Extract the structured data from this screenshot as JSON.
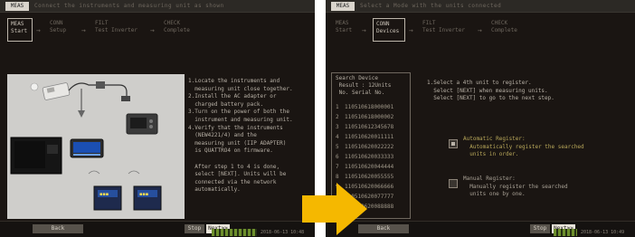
{
  "colors": {
    "arrow": "#f5b800",
    "screen_bg": "#1a1512",
    "highlight_option": "#b9a85a",
    "status_green": "#6d8f2c"
  },
  "left": {
    "title_tab": "MEAS",
    "topbar_text": "Connect the instruments and measuring unit as shown",
    "steps": [
      {
        "label": "MEAS\nStart"
      },
      {
        "label": "CONN\nSetup"
      },
      {
        "label": "FILT\nTest Inverter"
      },
      {
        "label": "CHECK\nComplete"
      }
    ],
    "instructions": "1.Locate the instruments and\n  measuring unit close together.\n2.Install the AC adapter or\n  charged battery pack.\n3.Turn on the power of both the\n  instrument and measuring unit.\n4.Verify that the instruments\n  (NEW4221/4) and the\n  measuring unit (IIP ADAPTER)\n  is QUATTRO4 on firmware.\n\n  After step 1 to 4 is done,\n  select [NEXT]. Units will be\n  connected via the network\n  automatically.",
    "buttons": {
      "back": "Back",
      "stop": "Stop",
      "next": "Next>>"
    },
    "status_text": "2018-06-13 10:48"
  },
  "right": {
    "title_tab": "MEAS",
    "topbar_text": "Select a Mode with the units connected",
    "steps": [
      {
        "label": "MEAS\nStart"
      },
      {
        "label": "CONN\nDevices"
      },
      {
        "label": "FILT\nTest Inverter"
      },
      {
        "label": "CHECK\nComplete"
      }
    ],
    "list": {
      "header": "Search Device\n Result : 12Units\n No. Serial No.",
      "rows": [
        {
          "idx": "1",
          "serial": "110510618000001"
        },
        {
          "idx": "2",
          "serial": "110510618000002"
        },
        {
          "idx": "3",
          "serial": "110510612345678"
        },
        {
          "idx": "4",
          "serial": "110510620011111"
        },
        {
          "idx": "5",
          "serial": "110510620022222"
        },
        {
          "idx": "6",
          "serial": "110510620033333"
        },
        {
          "idx": "7",
          "serial": "110510620044444"
        },
        {
          "idx": "8",
          "serial": "110510620055555"
        },
        {
          "idx": "9",
          "serial": "110510620066666"
        },
        {
          "idx": "10",
          "serial": "110510620077777"
        },
        {
          "idx": "11",
          "serial": "110510620088888"
        }
      ]
    },
    "instructions": "1.Select a 4th unit to register.\n  Select [NEXT] when measuring units.\n  Select [NEXT] to go to the next step.",
    "option_auto": "Automatic Register:\n  Automatically register the searched\n  units in order.",
    "option_manual": "Manual Register:\n  Manually register the searched\n  units one by one.",
    "buttons": {
      "back": "Back",
      "stop": "Stop",
      "next": "Next>>"
    },
    "status_text": "2018-06-13 10:49"
  }
}
